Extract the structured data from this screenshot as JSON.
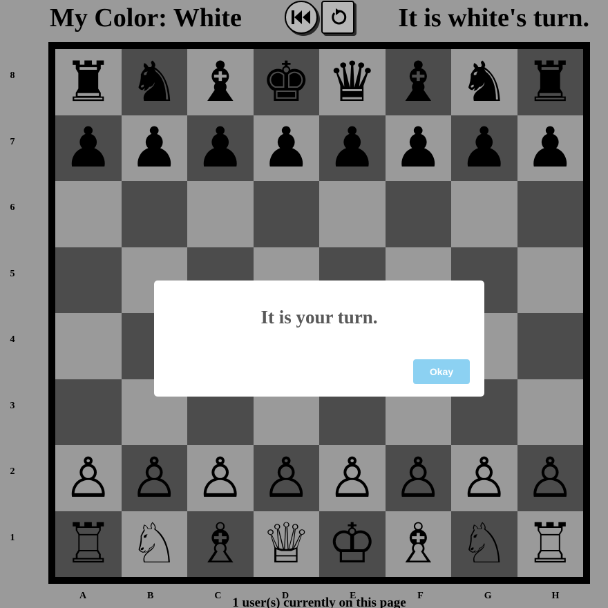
{
  "header": {
    "my_color": "My Color: White",
    "turn_status": "It is white's turn."
  },
  "controls": {
    "first_move_icon": "skip-to-start-icon",
    "reset_icon": "rotate-icon"
  },
  "board": {
    "light_color": "#9a9a9a",
    "dark_color": "#4c4c4c",
    "ranks": [
      "8",
      "7",
      "6",
      "5",
      "4",
      "3",
      "2",
      "1"
    ],
    "files": [
      "A",
      "B",
      "C",
      "D",
      "E",
      "F",
      "G",
      "H"
    ],
    "position": [
      [
        "bR",
        "bN",
        "bB",
        "bK",
        "bQ",
        "bB",
        "bN",
        "bR"
      ],
      [
        "bP",
        "bP",
        "bP",
        "bP",
        "bP",
        "bP",
        "bP",
        "bP"
      ],
      [
        "",
        "",
        "",
        "",
        "",
        "",
        "",
        ""
      ],
      [
        "",
        "",
        "",
        "",
        "",
        "",
        "",
        ""
      ],
      [
        "",
        "",
        "",
        "",
        "",
        "",
        "",
        ""
      ],
      [
        "",
        "",
        "",
        "",
        "",
        "",
        "",
        ""
      ],
      [
        "wP",
        "wP",
        "wP",
        "wP",
        "wP",
        "wP",
        "wP",
        "wP"
      ],
      [
        "wR",
        "wN",
        "wB",
        "wQ",
        "wK",
        "wB",
        "wN",
        "wR"
      ]
    ]
  },
  "footer": {
    "users_online": "1 user(s) currently on this page"
  },
  "modal": {
    "message": "It is your turn.",
    "okay_label": "Okay",
    "okay_color": "#8cd1f2"
  }
}
